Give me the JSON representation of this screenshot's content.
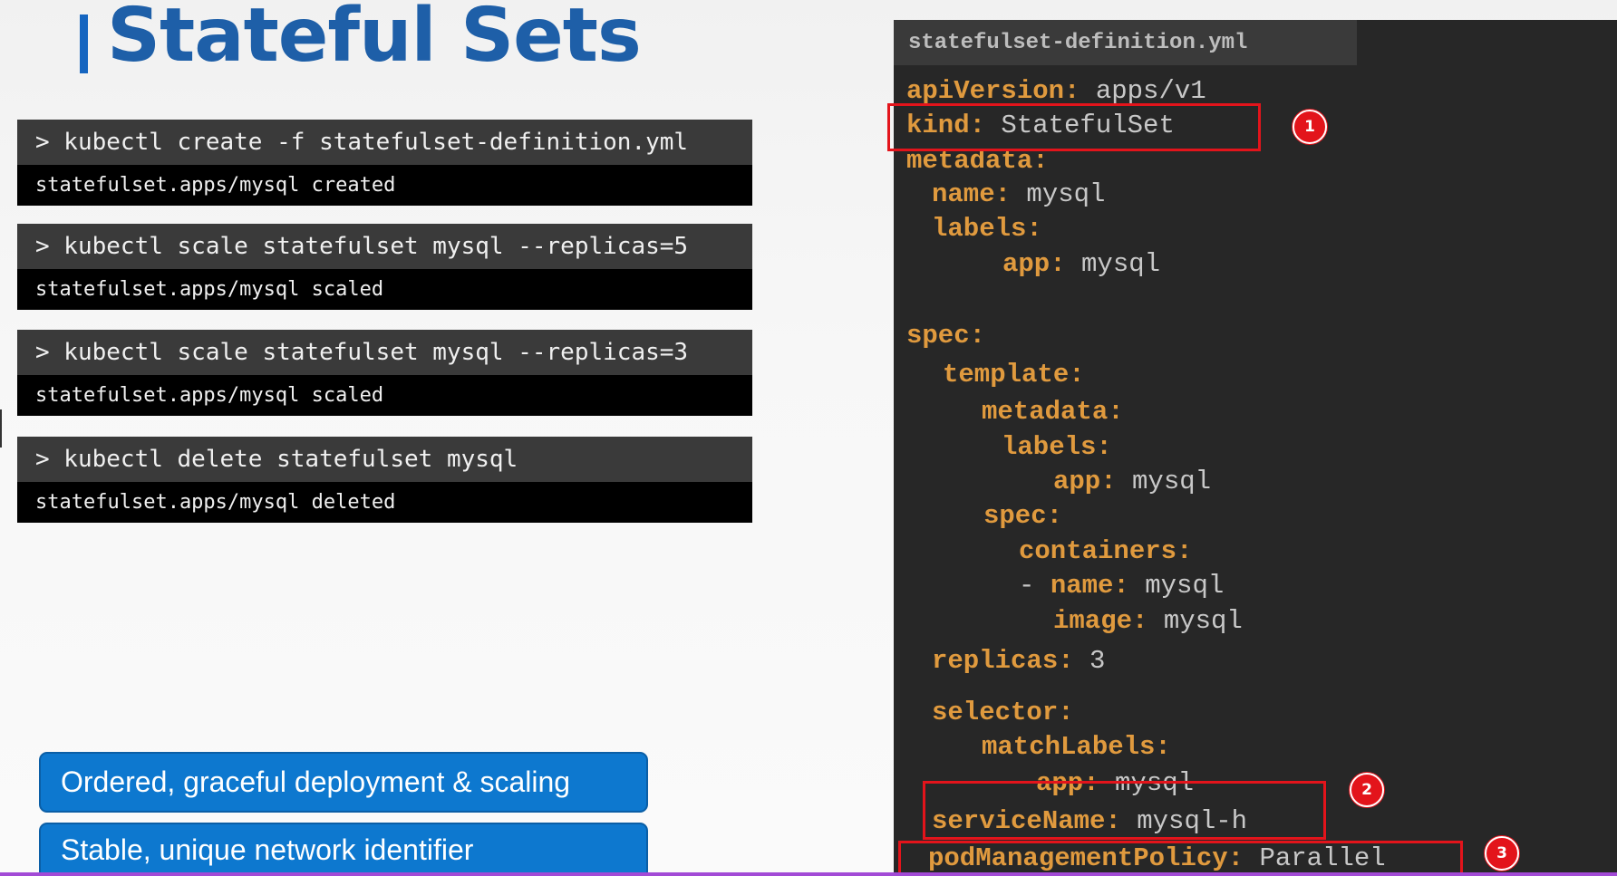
{
  "title": "Stateful Sets",
  "commands": [
    {
      "input": "> kubectl create -f statefulset-definition.yml",
      "output": "statefulset.apps/mysql created"
    },
    {
      "input": "> kubectl scale statefulset mysql --replicas=5",
      "output": "statefulset.apps/mysql scaled"
    },
    {
      "input": "> kubectl scale statefulset mysql --replicas=3",
      "output": "statefulset.apps/mysql scaled"
    },
    {
      "input": "> kubectl delete statefulset mysql",
      "output": "statefulset.apps/mysql deleted"
    }
  ],
  "features": [
    "Ordered, graceful deployment & scaling",
    "Stable, unique network identifier"
  ],
  "file": {
    "name": "statefulset-definition.yml",
    "lines": [
      {
        "key": "apiVersion:",
        "value": " apps/v1"
      },
      {
        "key": "kind:",
        "value": " StatefulSet"
      },
      {
        "key": "metadata:",
        "value": ""
      },
      {
        "key": "name:",
        "value": " mysql"
      },
      {
        "key": "labels:",
        "value": ""
      },
      {
        "key": "app:",
        "value": " mysql"
      },
      {
        "key": "spec:",
        "value": ""
      },
      {
        "key": "template:",
        "value": ""
      },
      {
        "key": "metadata:",
        "value": ""
      },
      {
        "key": "labels:",
        "value": ""
      },
      {
        "key": "app:",
        "value": " mysql"
      },
      {
        "key": "spec:",
        "value": ""
      },
      {
        "key": "containers:",
        "value": ""
      },
      {
        "key": "name:",
        "value": " mysql"
      },
      {
        "key": "image:",
        "value": " mysql"
      },
      {
        "key": "replicas:",
        "value": " 3"
      },
      {
        "key": "selector:",
        "value": ""
      },
      {
        "key": "matchLabels:",
        "value": ""
      },
      {
        "key": "app:",
        "value": " mysql"
      },
      {
        "key": "serviceName:",
        "value": " mysql-h"
      },
      {
        "key": "podManagementPolicy:",
        "value": " Parallel"
      }
    ],
    "list_dash": "- "
  },
  "badges": [
    "1",
    "2",
    "3"
  ],
  "colors": {
    "key": "#e09a3e",
    "value": "#c8c8c8",
    "highlight": "#e3141b",
    "accent": "#1e5fa8"
  }
}
